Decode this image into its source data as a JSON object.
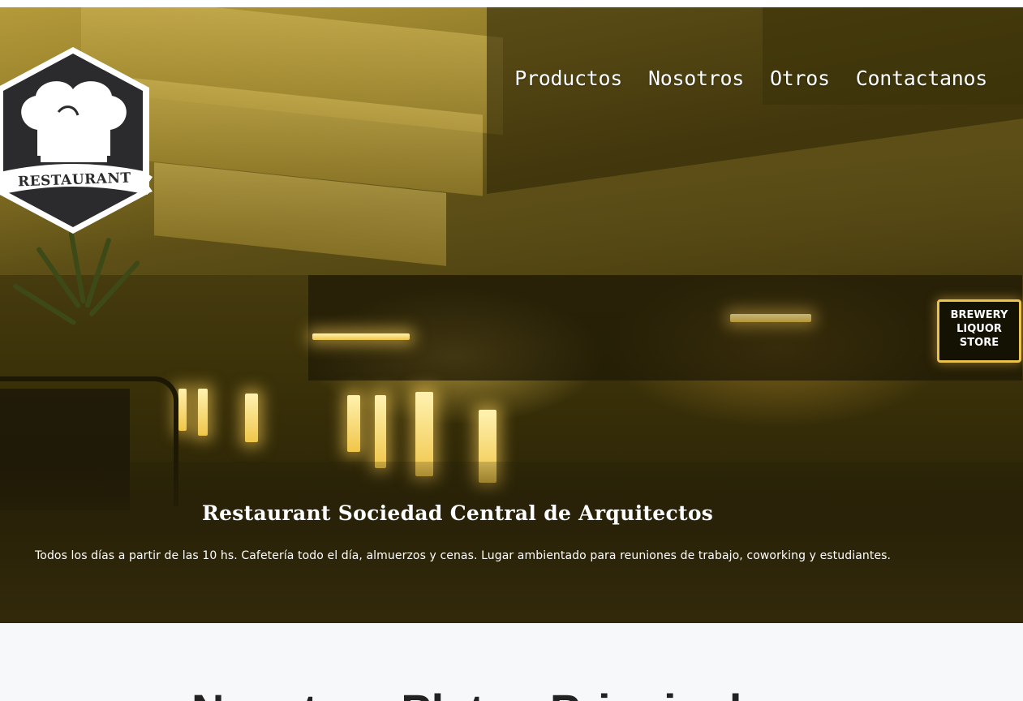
{
  "brand": {
    "logo_text": "RESTAURANT",
    "logo_icon": "chef-hat-icon"
  },
  "nav": {
    "items": [
      {
        "label": "Productos"
      },
      {
        "label": "Nosotros"
      },
      {
        "label": "Otros"
      },
      {
        "label": "Contactanos"
      }
    ]
  },
  "hero": {
    "title": "Restaurant Sociedad Central de Arquitectos",
    "description": "Todos los días a partir de las 10 hs. Cafetería todo el día, almuerzos y cenas. Lugar ambientado para reuniones de trabajo, coworking y estudiantes.",
    "sign_text": "BREWERY LIQUOR STORE"
  },
  "section": {
    "title": "Nuestros Platos Principales"
  },
  "colors": {
    "hero_tint": "#4d4112",
    "nav_text": "#ffffff",
    "logo_fill": "#2b2b2d",
    "section_bg": "#f7f8fa"
  }
}
